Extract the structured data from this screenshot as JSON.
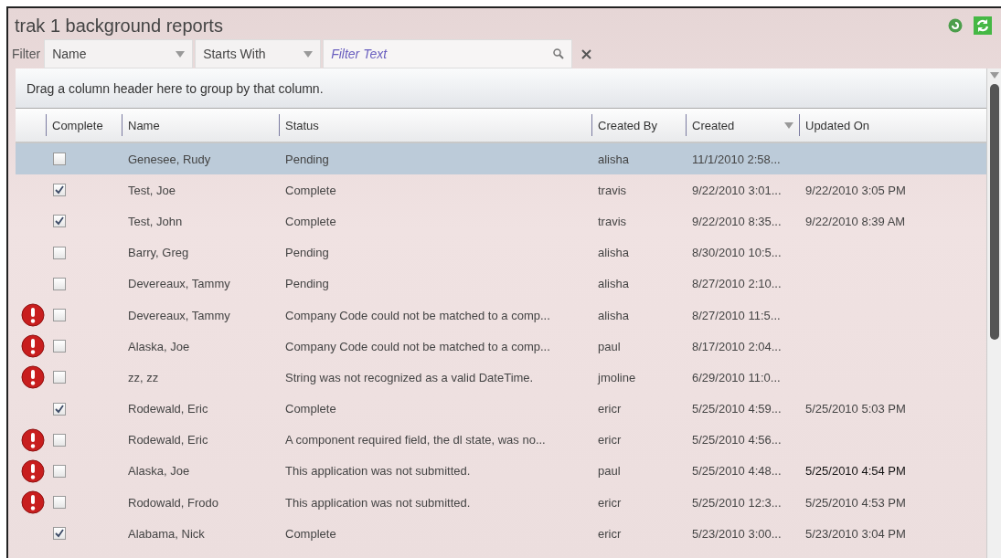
{
  "title": "trak 1 background reports",
  "filter": {
    "label": "Filter",
    "field": "Name",
    "operator": "Starts With",
    "placeholder": "Filter Text"
  },
  "group_hint": "Drag a column header here to group by that column.",
  "columns": [
    {
      "label": "Complete",
      "sorted": false
    },
    {
      "label": "Name",
      "sorted": false
    },
    {
      "label": "Status",
      "sorted": false
    },
    {
      "label": "Created By",
      "sorted": false
    },
    {
      "label": "Created",
      "sorted": true
    },
    {
      "label": "Updated On",
      "sorted": false
    }
  ],
  "rows": [
    {
      "selected": true,
      "error": false,
      "complete": false,
      "name": "Genesee, Rudy",
      "status": "Pending",
      "created_by": "alisha",
      "created": "11/1/2010 2:58...",
      "updated_on": ""
    },
    {
      "selected": false,
      "error": false,
      "complete": true,
      "name": "Test, Joe",
      "status": "Complete",
      "created_by": "travis",
      "created": "9/22/2010 3:01...",
      "updated_on": "9/22/2010 3:05 PM"
    },
    {
      "selected": false,
      "error": false,
      "complete": true,
      "name": "Test, John",
      "status": "Complete",
      "created_by": "travis",
      "created": "9/22/2010 8:35...",
      "updated_on": "9/22/2010 8:39 AM"
    },
    {
      "selected": false,
      "error": false,
      "complete": false,
      "name": "Barry, Greg",
      "status": "Pending",
      "created_by": "alisha",
      "created": "8/30/2010 10:5...",
      "updated_on": ""
    },
    {
      "selected": false,
      "error": false,
      "complete": false,
      "name": "Devereaux, Tammy",
      "status": "Pending",
      "created_by": "alisha",
      "created": "8/27/2010 2:10...",
      "updated_on": ""
    },
    {
      "selected": false,
      "error": true,
      "complete": false,
      "name": "Devereaux, Tammy",
      "status": "Company Code could not be matched to a comp...",
      "created_by": "alisha",
      "created": "8/27/2010 11:5...",
      "updated_on": ""
    },
    {
      "selected": false,
      "error": true,
      "complete": false,
      "name": "Alaska, Joe",
      "status": "Company Code could not be matched to a comp...",
      "created_by": "paul",
      "created": "8/17/2010 2:04...",
      "updated_on": ""
    },
    {
      "selected": false,
      "error": true,
      "complete": false,
      "name": "zz, zz",
      "status": "String was not recognized as a valid DateTime.",
      "created_by": "jmoline",
      "created": "6/29/2010 11:0...",
      "updated_on": ""
    },
    {
      "selected": false,
      "error": false,
      "complete": true,
      "name": "Rodewald, Eric",
      "status": "Complete",
      "created_by": "ericr",
      "created": "5/25/2010 4:59...",
      "updated_on": "5/25/2010 5:03 PM"
    },
    {
      "selected": false,
      "error": true,
      "complete": false,
      "name": "Rodewald, Eric",
      "status": "A component required field, the dl state, was no...",
      "created_by": "ericr",
      "created": "5/25/2010 4:56...",
      "updated_on": ""
    },
    {
      "selected": false,
      "error": true,
      "complete": false,
      "name": "Alaska, Joe",
      "status": "This application was not submitted.",
      "created_by": "paul",
      "created": "5/25/2010 4:48...",
      "updated_on": "5/25/2010 4:54 PM"
    },
    {
      "selected": false,
      "error": true,
      "complete": false,
      "name": "Rodowald, Frodo",
      "status": "This application was not submitted.",
      "created_by": "ericr",
      "created": "5/25/2010 12:3...",
      "updated_on": "5/25/2010 4:53 PM"
    },
    {
      "selected": false,
      "error": false,
      "complete": true,
      "name": "Alabama, Nick",
      "status": "Complete",
      "created_by": "ericr",
      "created": "5/23/2010 3:00...",
      "updated_on": "5/23/2010 3:04 PM"
    }
  ]
}
